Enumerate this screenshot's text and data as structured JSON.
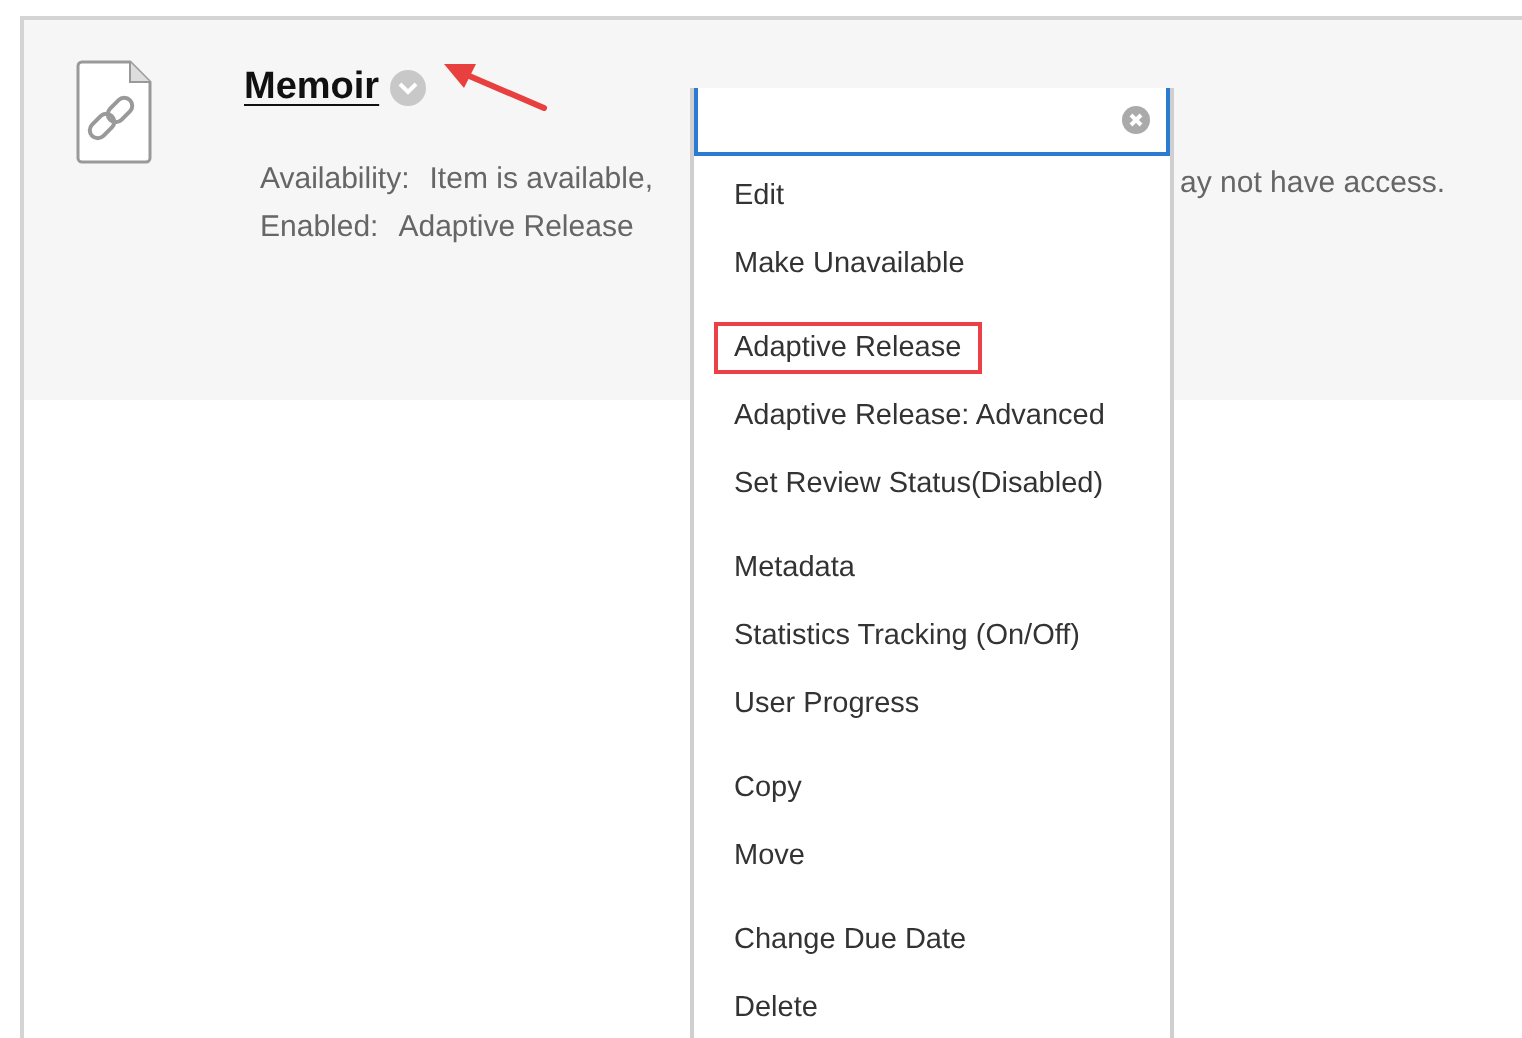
{
  "item": {
    "title": "Memoir",
    "details": [
      {
        "label": "Availability:",
        "value": "Item is available,",
        "tail": "ay not have access."
      },
      {
        "label": "Enabled:",
        "value": "Adaptive Release"
      }
    ]
  },
  "menu": {
    "groups": [
      [
        {
          "label": "Edit",
          "highlighted": false
        },
        {
          "label": "Make Unavailable",
          "highlighted": false
        }
      ],
      [
        {
          "label": "Adaptive Release",
          "highlighted": true
        },
        {
          "label": "Adaptive Release: Advanced",
          "highlighted": false
        },
        {
          "label": "Set Review Status(Disabled)",
          "highlighted": false
        }
      ],
      [
        {
          "label": "Metadata",
          "highlighted": false
        },
        {
          "label": "Statistics Tracking (On/Off)",
          "highlighted": false
        },
        {
          "label": "User Progress",
          "highlighted": false
        }
      ],
      [
        {
          "label": "Copy",
          "highlighted": false
        },
        {
          "label": "Move",
          "highlighted": false
        }
      ],
      [
        {
          "label": "Change Due Date",
          "highlighted": false
        },
        {
          "label": "Delete",
          "highlighted": false
        }
      ]
    ]
  }
}
